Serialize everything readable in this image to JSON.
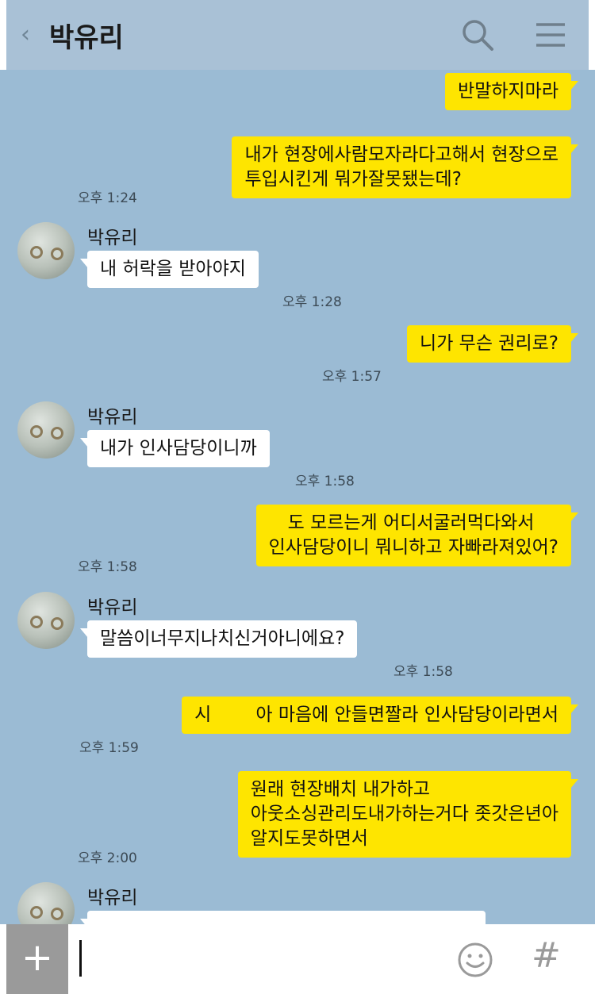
{
  "header": {
    "back": "‹",
    "title": "박유리",
    "search_icon": "search-icon",
    "menu_icon": "menu-icon"
  },
  "messages": [
    {
      "side": "me",
      "lines": [
        "반말하지마라"
      ],
      "time": ""
    },
    {
      "side": "me",
      "lines": [
        "내가 현장에사람모자라다고해서 현장으로",
        "투입시킨게 뭐가잘못됐는데?"
      ],
      "time": "오후 1:24"
    },
    {
      "side": "them",
      "name": "박유리",
      "lines": [
        "내 허락을 받아야지"
      ],
      "time": "오후 1:28"
    },
    {
      "side": "me",
      "lines": [
        "니가 무슨 권리로?"
      ],
      "time": "오후 1:57"
    },
    {
      "side": "them",
      "name": "박유리",
      "lines": [
        "내가 인사담당이니까"
      ],
      "time": "오후 1:58"
    },
    {
      "side": "me",
      "lines": [
        "도 모르는게 어디서굴러먹다와서",
        "인사담당이니 뭐니하고 자빠라져있어?"
      ],
      "time": "오후 1:58"
    },
    {
      "side": "them",
      "name": "박유리",
      "lines": [
        "말씀이너무지나치신거아니에요?"
      ],
      "time": "오후 1:58"
    },
    {
      "side": "me",
      "lines": [
        "시",
        "아 마음에 안들면짤라 인사담당이라면서"
      ],
      "time": "오후 1:59"
    },
    {
      "side": "me",
      "lines": [
        "원래 현장배치 내가하고",
        "아웃소싱관리도내가하는거다 좃갓은년아",
        "알지도못하면서"
      ],
      "time": "오후 2:00"
    },
    {
      "side": "them",
      "name": "박유리",
      "lines": [],
      "time": ""
    }
  ],
  "input": {
    "plus": "+",
    "emoji_icon": "smile-icon",
    "hash": "#"
  },
  "colors": {
    "background": "#9bbbd4",
    "my_bubble": "#fee500",
    "their_bubble": "#ffffff"
  }
}
